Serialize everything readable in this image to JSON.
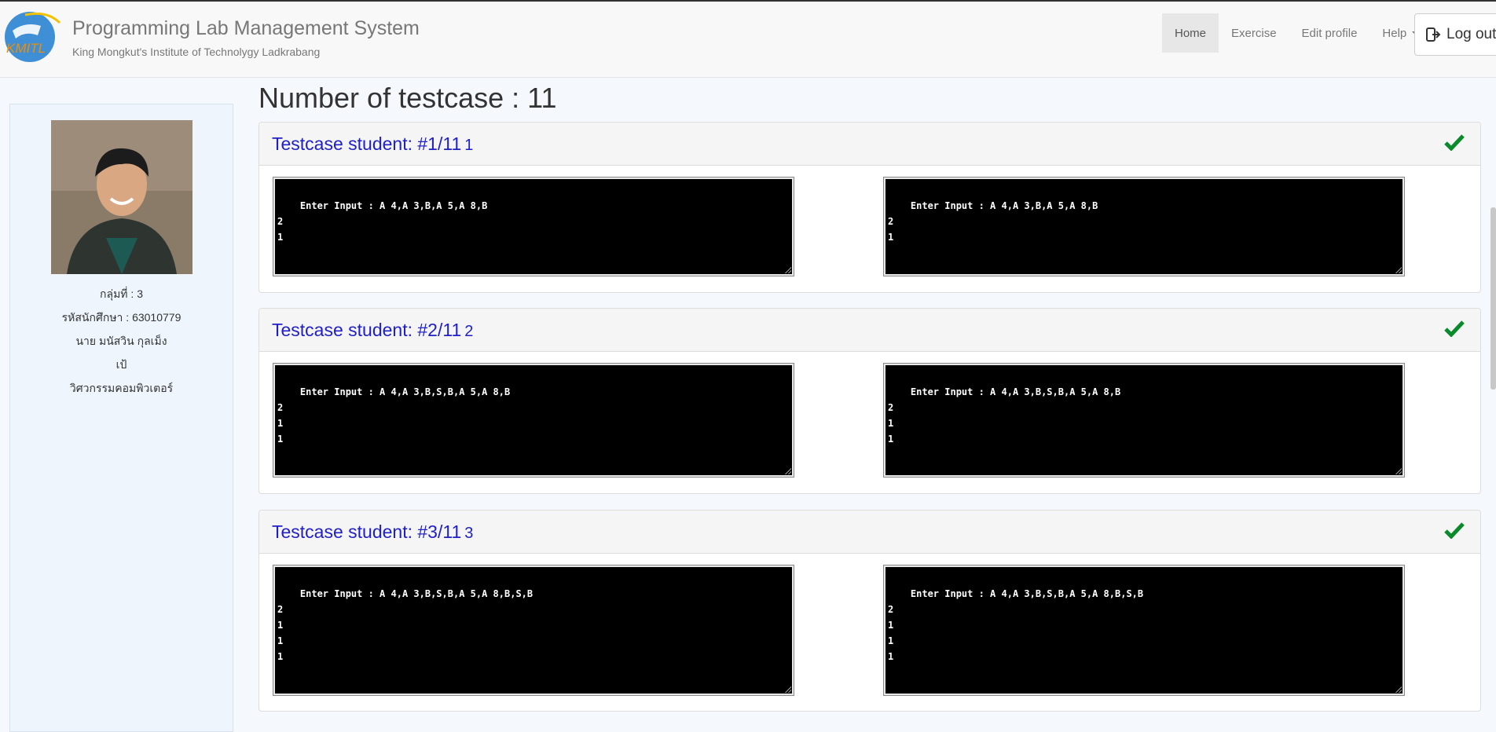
{
  "brand": {
    "title": "Programming Lab Management System",
    "subtitle": "King Mongkut's Institute of Technolygy Ladkrabang",
    "logo_text": "KMITL"
  },
  "nav": {
    "home": "Home",
    "exercise": "Exercise",
    "edit_profile": "Edit profile",
    "help": "Help",
    "logout": "Log out"
  },
  "student": {
    "group": "กลุ่มที่ : 3",
    "student_id": "รหัสนักศึกษา : 63010779",
    "name": "นาย มนัสวิน กุลเม็ง",
    "nickname": "เป้",
    "faculty": "วิศวกรรมคอมพิวเตอร์"
  },
  "main": {
    "title": "Number of testcase : 11"
  },
  "testcases": [
    {
      "title": "Testcase student: #1/11",
      "num": "1",
      "status": "passed",
      "student_output": "Enter Input : A 4,A 3,B,A 5,A 8,B\n2\n1",
      "expected_output": "Enter Input : A 4,A 3,B,A 5,A 8,B\n2\n1"
    },
    {
      "title": "Testcase student: #2/11",
      "num": "2",
      "status": "passed",
      "student_output": "Enter Input : A 4,A 3,B,S,B,A 5,A 8,B\n2\n1\n1",
      "expected_output": "Enter Input : A 4,A 3,B,S,B,A 5,A 8,B\n2\n1\n1"
    },
    {
      "title": "Testcase student: #3/11",
      "num": "3",
      "status": "passed",
      "student_output": "Enter Input : A 4,A 3,B,S,B,A 5,A 8,B,S,B\n2\n1\n1\n1",
      "expected_output": "Enter Input : A 4,A 3,B,S,B,A 5,A 8,B,S,B\n2\n1\n1\n1"
    }
  ],
  "colors": {
    "check": "#0a8a2a",
    "panel_title": "#1f1fc8"
  }
}
